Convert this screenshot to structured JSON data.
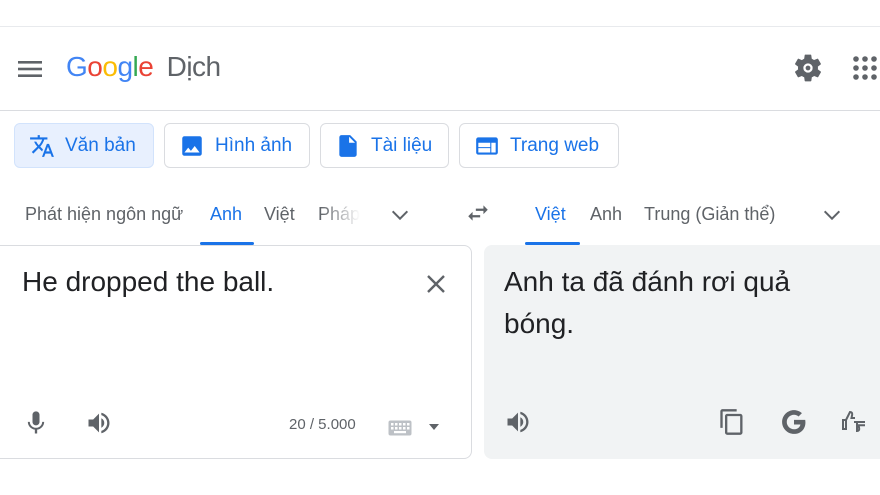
{
  "header": {
    "logo_letters": [
      "G",
      "o",
      "o",
      "g",
      "l",
      "e"
    ],
    "logo_colors": [
      "#4285F4",
      "#EA4335",
      "#FBBC05",
      "#4285F4",
      "#34A853",
      "#EA4335"
    ],
    "product_name": "Dịch"
  },
  "modes": [
    {
      "label": "Văn bản",
      "icon": "translate-icon",
      "active": true
    },
    {
      "label": "Hình ảnh",
      "icon": "image-icon",
      "active": false
    },
    {
      "label": "Tài liệu",
      "icon": "document-icon",
      "active": false
    },
    {
      "label": "Trang web",
      "icon": "web-icon",
      "active": false
    }
  ],
  "source_languages": [
    "Phát hiện ngôn ngữ",
    "Anh",
    "Việt",
    "Pháp"
  ],
  "source_selected": "Anh",
  "target_languages": [
    "Việt",
    "Anh",
    "Trung (Giản thể)"
  ],
  "target_selected": "Việt",
  "source": {
    "text": "He dropped the ball.",
    "char_count": "20 / 5.000"
  },
  "target": {
    "text": "Anh ta đã đánh rơi quả bóng."
  },
  "colors": {
    "accent": "#1a73e8",
    "active_mode_bg": "#e8f0fe",
    "target_bg": "#f1f3f4",
    "icon_gray": "#5f6368"
  }
}
